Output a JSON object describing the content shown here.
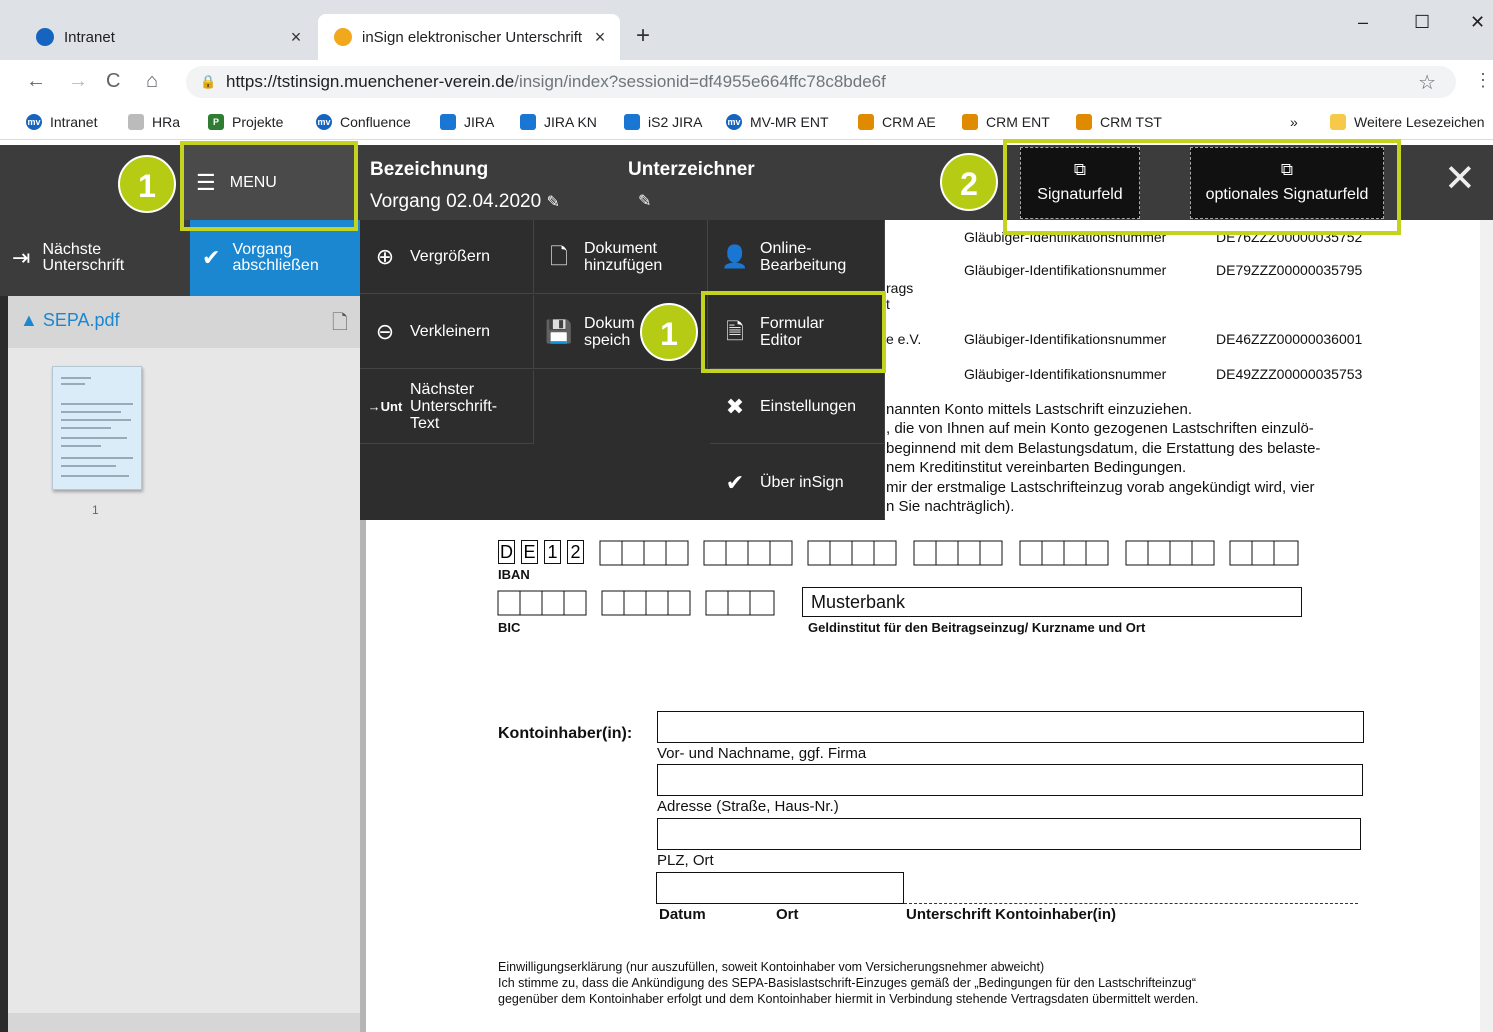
{
  "browser": {
    "tabs": [
      {
        "label": "Intranet",
        "close": "×"
      },
      {
        "label": "inSign elektronischer Unterschrift",
        "close": "×"
      }
    ],
    "new_tab": "+",
    "win": {
      "min": "–",
      "max": "☐",
      "close": "✕"
    },
    "url_host": "https://tstinsign.muenchener-verein.de",
    "url_path": "/insign/index?sessionid=df4955e664ffc78c8bde6f",
    "bookmarks": [
      "Intranet",
      "HRa",
      "Projekte",
      "Confluence",
      "JIRA",
      "JIRA KN",
      "iS2 JIRA",
      "MV-MR ENT",
      "CRM AE",
      "CRM ENT",
      "CRM TST"
    ],
    "bookmarks_more": "»",
    "other_bookmarks": "Weitere Lesezeichen"
  },
  "header": {
    "menu_label": "MENU",
    "col1_title": "Bezeichnung",
    "col1_value": "Vorgang 02.04.2020",
    "col2_title": "Unterzeichner",
    "sig1": "Signaturfeld",
    "sig2": "optionales Signaturfeld"
  },
  "left": {
    "next_line1": "Nächste",
    "next_line2": "Unterschrift",
    "finish_line1": "Vorgang",
    "finish_line2": "abschließen",
    "file": "SEPA.pdf",
    "page": "1"
  },
  "menu": {
    "zoom_in": "Vergrößern",
    "add_doc_1": "Dokument",
    "add_doc_2": "hinzufügen",
    "online_1": "Online-",
    "online_2": "Bearbeitung",
    "zoom_out": "Verkleinern",
    "save_1": "Dokum",
    "save_2": "speich",
    "form_1": "Formular",
    "form_2": "Editor",
    "next_1": "Nächster",
    "next_2": "Unterschrift-",
    "next_3": "Text",
    "settings": "Einstellungen",
    "about": "Über inSign"
  },
  "badges": {
    "b1": "1",
    "b2": "2"
  },
  "doc": {
    "r0_label": "Gläubiger-Identifikationsnummer",
    "r0_val": "DE76ZZZ00000035752",
    "r1_label": "Gläubiger-Identifikationsnummer",
    "r1_val": "DE79ZZZ00000035795",
    "r2_label": "Gläubiger-Identifikationsnummer",
    "r2_val": "DE46ZZZ00000036001",
    "r3_label": "Gläubiger-Identifikationsnummer",
    "r3_val": "DE49ZZZ00000035753",
    "frag_rags": "rags",
    "frag_t": "t",
    "frag_ev": "e e.V.",
    "text_lines": [
      "nannten Konto mittels Lastschrift einzuziehen.",
      ", die von Ihnen auf mein Konto gezogenen Lastschriften einzulö-",
      "beginnend mit dem Belastungsdatum, die Erstattung des belaste-",
      "nem Kreditinstitut vereinbarten Bedingungen.",
      "mir der erstmalige Lastschrifteinzug vorab angekündigt wird, vier",
      "n Sie nachträglich)."
    ],
    "iban_chars": [
      "D",
      "E",
      "1",
      "2"
    ],
    "iban_label": "IBAN",
    "bic_label": "BIC",
    "bank_value": "Musterbank",
    "bank_caption": "Geldinstitut für den Beitragseinzug/ Kurzname und Ort",
    "owner_label": "Kontoinhaber(in):",
    "name_caption": "Vor- und Nachname, ggf. Firma",
    "addr_caption": "Adresse (Straße, Haus-Nr.)",
    "plz_caption": "PLZ, Ort",
    "datum": "Datum",
    "ort": "Ort",
    "unterschrift": "Unterschrift Kontoinhaber(in)",
    "consent_lines": [
      "Einwilligungserklärung (nur auszufüllen, soweit Kontoinhaber vom Versicherungsnehmer abweicht)",
      "Ich stimme zu, dass die Ankündigung des SEPA-Basislastschrift-Einzuges gemäß der „Bedingungen für den Lastschrifteinzug“",
      "gegenüber dem Kontoinhaber erfolgt und dem Kontoinhaber hiermit in Verbindung stehende Vertragsdaten übermittelt werden."
    ]
  }
}
